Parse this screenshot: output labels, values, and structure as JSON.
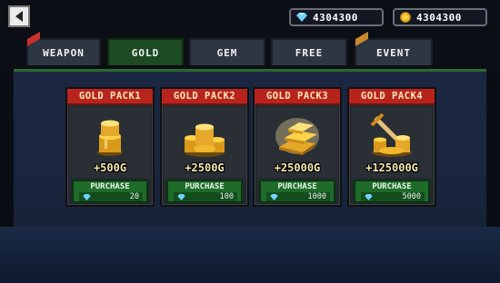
{
  "currencies": {
    "gems": {
      "value": "4304300",
      "icon": "diamond-icon"
    },
    "gold": {
      "value": "4304300",
      "icon": "gold-coin-icon"
    }
  },
  "tabs": [
    {
      "label": "WEAPON",
      "badge": "new-badge"
    },
    {
      "label": "GOLD",
      "active": true
    },
    {
      "label": "GEM"
    },
    {
      "label": "FREE"
    },
    {
      "label": "EVENT",
      "badge": "event-badge"
    }
  ],
  "packs": [
    {
      "title": "GOLD PACK1",
      "amount": "+500G",
      "purchase_label": "PURCHASE",
      "price": "20",
      "price_icon": "diamond-icon",
      "art": "small-coin-stack-icon"
    },
    {
      "title": "GOLD PACK2",
      "amount": "+2500G",
      "purchase_label": "PURCHASE",
      "price": "100",
      "price_icon": "diamond-icon",
      "art": "coin-pile-icon"
    },
    {
      "title": "GOLD PACK3",
      "amount": "+25000G",
      "purchase_label": "PURCHASE",
      "price": "1000",
      "price_icon": "diamond-icon",
      "art": "gold-bars-icon"
    },
    {
      "title": "GOLD PACK4",
      "amount": "+125000G",
      "purchase_label": "PURCHASE",
      "price": "5000",
      "price_icon": "diamond-icon",
      "art": "treasure-sword-icon"
    }
  ],
  "colors": {
    "tab_active": "#1c4a22",
    "card_header": "#b8241d",
    "purchase_button": "#1e6b2a",
    "gold_text": "#f3e6b0"
  }
}
